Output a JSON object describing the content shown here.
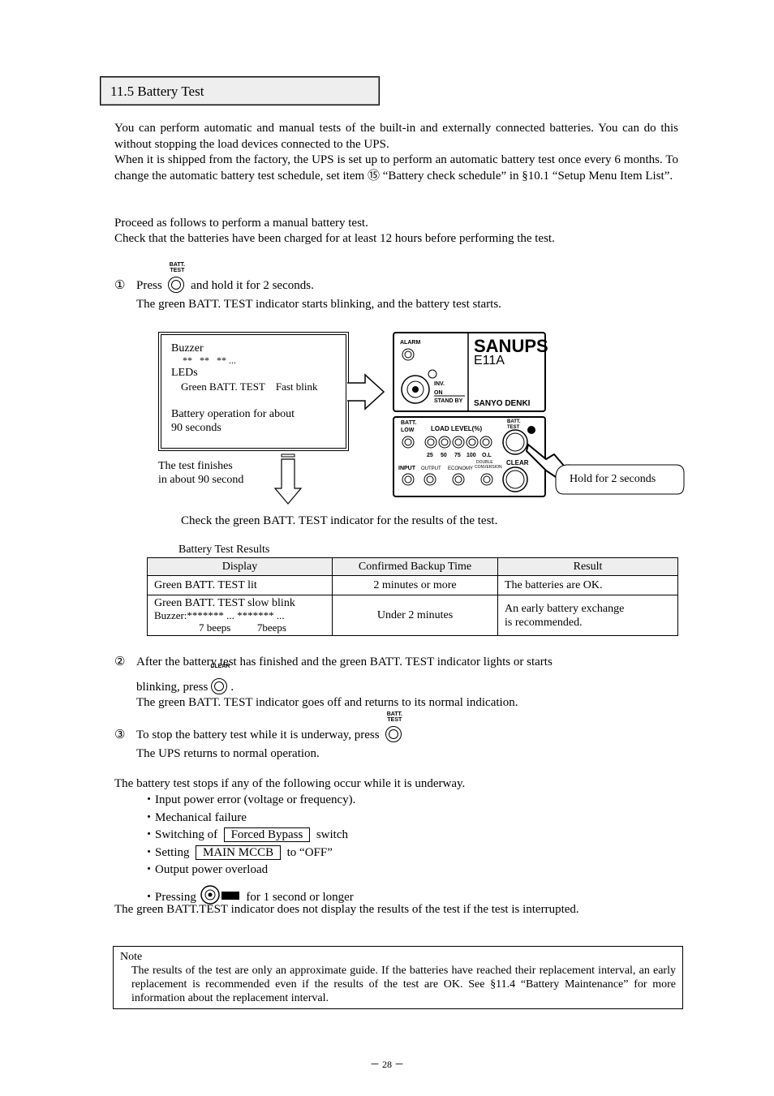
{
  "section_title": "11.5 Battery Test",
  "intro": [
    "You can perform automatic and manual tests of the built-in and externally connected batteries. You can do this without stopping the load devices connected to the UPS.",
    "When it is shipped from the factory, the UPS is set up to perform an automatic battery test once every 6 months. To change the automatic battery test schedule, set item ⑮ “Battery check schedule” in §10.1 “Setup Menu Item List”.",
    "Proceed as follows to perform a manual battery test.",
    "Check that the batteries have been charged for at least 12 hours before performing the test."
  ],
  "step1": {
    "num": "①",
    "pre": "Press",
    "button": "BATT. TEST",
    "post": "and hold it for 2 seconds.",
    "line2": "The green BATT. TEST indicator starts blinking, and the battery test starts."
  },
  "infobox": {
    "buzzer_label": "Buzzer",
    "buzzer_pattern": "**   **   ** ...",
    "leds_label": "LEDs",
    "led_name": "Green BATT. TEST",
    "led_state": "Fast blink",
    "operation": "Battery operation for about",
    "operation2": "90 seconds"
  },
  "finish_note": [
    "The  test  finishes",
    "in  about  90  second"
  ],
  "panel": {
    "brand": "SANUPS",
    "model": "E11A",
    "maker": "SANYO DENKI",
    "alarm": "ALARM",
    "inv": "INV.",
    "on": "ON",
    "standby": "STAND BY",
    "batt_low": [
      "BATT.",
      "LOW"
    ],
    "load_level": "LOAD LEVEL(%)",
    "load_ticks": [
      "25",
      "50",
      "75",
      "100",
      "O.L"
    ],
    "batt_test": [
      "BATT.",
      "TEST"
    ],
    "input": "INPUT",
    "output": "OUTPUT",
    "economy": "ECONOMY",
    "double_conversion": [
      "DOUBLE",
      "CONVERSION"
    ],
    "clear": "CLEAR"
  },
  "callout": "Hold for 2 seconds",
  "check_text": "Check the green BATT. TEST indicator for the results of the test.",
  "table": {
    "caption": "Battery Test Results",
    "headers": [
      "Display",
      "Confirmed Backup Time",
      "Result"
    ],
    "rows": [
      {
        "display": [
          "Green BATT. TEST lit"
        ],
        "time": "2 minutes or more",
        "result": [
          "The batteries are OK."
        ]
      },
      {
        "display": [
          "Green BATT. TEST slow blink",
          "Buzzer:******* ... ******* ...",
          "7 beeps          7beeps"
        ],
        "time": "Under 2 minutes",
        "result": [
          "An early battery exchange",
          "is recommended."
        ]
      }
    ]
  },
  "step2": {
    "num": "②",
    "line1": "After the battery test has finished and the green BATT. TEST indicator lights or starts",
    "pre": "blinking, press",
    "button": "CLEAR",
    "post": ".",
    "line3": "The green BATT. TEST indicator goes off and returns to its normal indication."
  },
  "step3": {
    "num": "③",
    "pre": "To stop the battery test while it is underway, press",
    "button": "BATT. TEST",
    "line2": "The UPS returns to normal operation."
  },
  "stops": {
    "intro": "The battery test stops if any of the following occur while it is underway.",
    "items": [
      "・Input power error (voltage or frequency).",
      "・Mechanical failure"
    ],
    "switching_pre": "・Switching of",
    "switching_box": "Forced Bypass",
    "switching_post": "switch",
    "setting_pre": "・Setting",
    "setting_box": "MAIN MCCB",
    "setting_post": "to “OFF”",
    "overload": "・Output power overload",
    "pressing_pre": "・Pressing",
    "pressing_post": "for 1 second or longer",
    "outro": "The green BATT.TEST indicator does not display the results of the test if the test is interrupted."
  },
  "note": {
    "label": "Note",
    "text": "The results of the test are only an approximate guide. If the batteries have reached their replacement interval, an early replacement is recommended even if the results of the test are OK. See §11.4 “Battery Maintenance” for more information about the replacement interval."
  },
  "page_number": "－ 28 －"
}
